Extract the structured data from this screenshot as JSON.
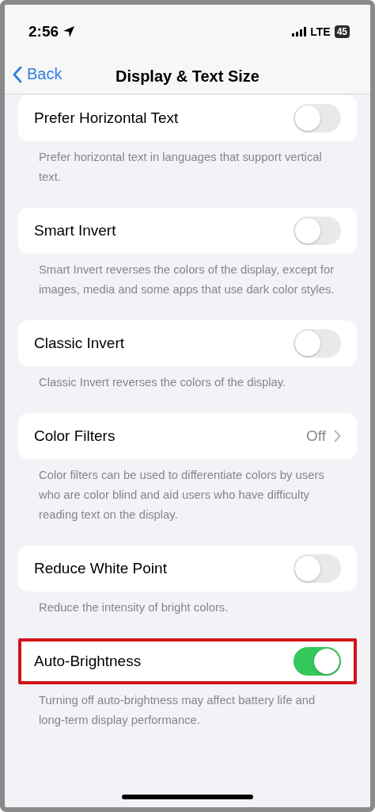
{
  "status_bar": {
    "time": "2:56",
    "network": "LTE",
    "battery": "45"
  },
  "nav": {
    "back": "Back",
    "title": "Display & Text Size"
  },
  "settings": [
    {
      "kind": "toggle",
      "label": "Prefer Horizontal Text",
      "on": false,
      "highlighted": false,
      "footer": "Prefer horizontal text in languages that support vertical text."
    },
    {
      "kind": "toggle",
      "label": "Smart Invert",
      "on": false,
      "highlighted": false,
      "footer": "Smart Invert reverses the colors of the display, except for images, media and some apps that use dark color styles."
    },
    {
      "kind": "toggle",
      "label": "Classic Invert",
      "on": false,
      "highlighted": false,
      "footer": "Classic Invert reverses the colors of the display."
    },
    {
      "kind": "link",
      "label": "Color Filters",
      "value": "Off",
      "highlighted": false,
      "footer": "Color filters can be used to differentiate colors by users who are color blind and aid users who have difficulty reading text on the display."
    },
    {
      "kind": "toggle",
      "label": "Reduce White Point",
      "on": false,
      "highlighted": false,
      "footer": "Reduce the intensity of bright colors."
    },
    {
      "kind": "toggle",
      "label": "Auto-Brightness",
      "on": true,
      "highlighted": true,
      "footer": "Turning off auto-brightness may affect battery life and long-term display performance."
    }
  ]
}
